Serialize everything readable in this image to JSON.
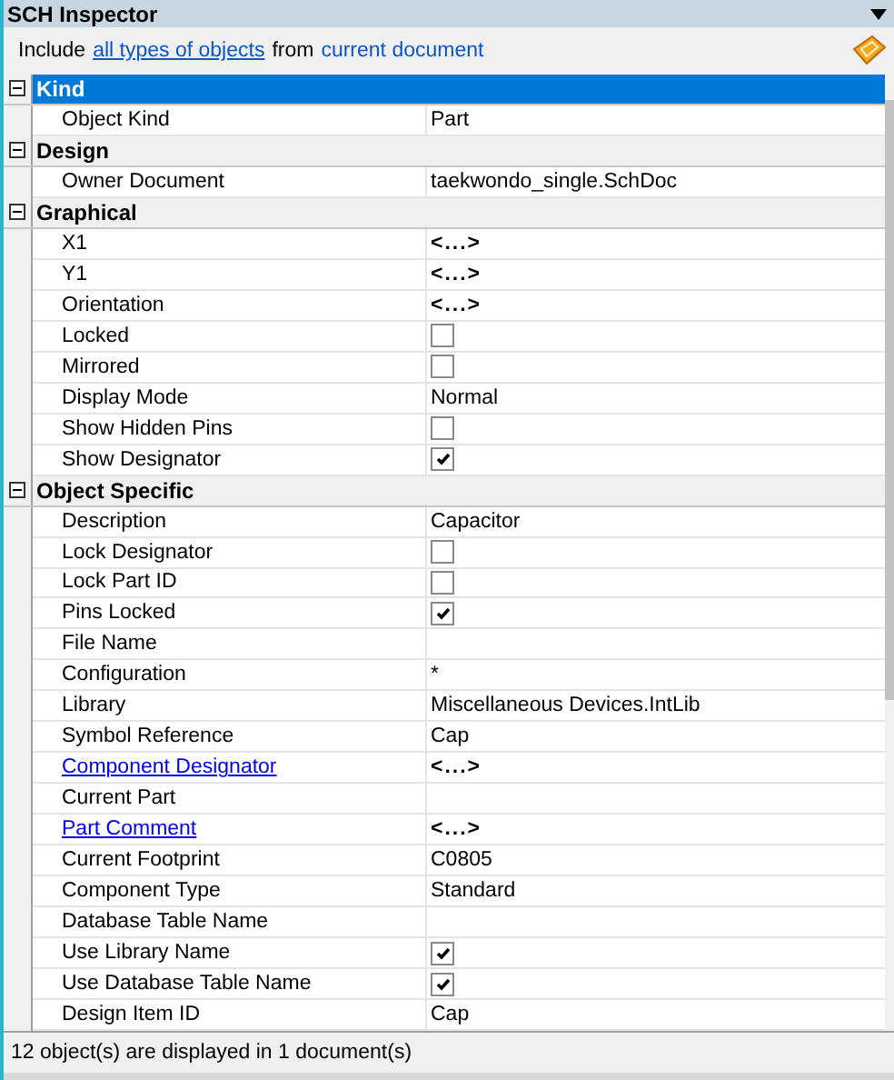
{
  "panel": {
    "title": "SCH Inspector"
  },
  "filter": {
    "prefix": "Include",
    "objects_link": "all types of objects",
    "middle": "from",
    "scope_link": "current document"
  },
  "categories": [
    {
      "name": "Kind",
      "selected": true,
      "expanded": true,
      "properties": [
        {
          "label": "Object Kind",
          "kind": "text",
          "link": false,
          "value": "Part"
        }
      ]
    },
    {
      "name": "Design",
      "selected": false,
      "expanded": true,
      "properties": [
        {
          "label": "Owner Document",
          "kind": "text",
          "link": false,
          "value": "taekwondo_single.SchDoc"
        }
      ]
    },
    {
      "name": "Graphical",
      "selected": false,
      "expanded": true,
      "properties": [
        {
          "label": "X1",
          "kind": "multi",
          "link": false,
          "value": "<...>"
        },
        {
          "label": "Y1",
          "kind": "multi",
          "link": false,
          "value": "<...>"
        },
        {
          "label": "Orientation",
          "kind": "multi",
          "link": false,
          "value": "<...>"
        },
        {
          "label": "Locked",
          "kind": "check",
          "link": false,
          "checked": false
        },
        {
          "label": "Mirrored",
          "kind": "check",
          "link": false,
          "checked": false
        },
        {
          "label": "Display Mode",
          "kind": "text",
          "link": false,
          "value": "Normal"
        },
        {
          "label": "Show Hidden Pins",
          "kind": "check",
          "link": false,
          "checked": false
        },
        {
          "label": "Show Designator",
          "kind": "check",
          "link": false,
          "checked": true
        }
      ]
    },
    {
      "name": "Object Specific",
      "selected": false,
      "expanded": true,
      "properties": [
        {
          "label": "Description",
          "kind": "text",
          "link": false,
          "value": "Capacitor"
        },
        {
          "label": "Lock Designator",
          "kind": "check",
          "link": false,
          "checked": false
        },
        {
          "label": "Lock Part ID",
          "kind": "check",
          "link": false,
          "checked": false
        },
        {
          "label": "Pins Locked",
          "kind": "check",
          "link": false,
          "checked": true
        },
        {
          "label": "File Name",
          "kind": "text",
          "link": false
        },
        {
          "label": "Configuration",
          "kind": "text",
          "link": false,
          "value": "*"
        },
        {
          "label": "Library",
          "kind": "text",
          "link": false,
          "value": "Miscellaneous Devices.IntLib"
        },
        {
          "label": "Symbol Reference",
          "kind": "text",
          "link": false,
          "value": "Cap"
        },
        {
          "label": "Component Designator",
          "kind": "multi",
          "link": true,
          "value": "<...>"
        },
        {
          "label": "Current Part",
          "kind": "text",
          "link": false
        },
        {
          "label": "Part Comment",
          "kind": "multi",
          "link": true,
          "value": "<...>"
        },
        {
          "label": "Current Footprint",
          "kind": "text",
          "link": false,
          "value": "C0805"
        },
        {
          "label": "Component Type",
          "kind": "text",
          "link": false,
          "value": "Standard"
        },
        {
          "label": "Database Table Name",
          "kind": "text",
          "link": false
        },
        {
          "label": "Use Library Name",
          "kind": "check",
          "link": false,
          "checked": true
        },
        {
          "label": "Use Database Table Name",
          "kind": "check",
          "link": false,
          "checked": true
        },
        {
          "label": "Design Item ID",
          "kind": "text",
          "link": false,
          "value": "Cap"
        }
      ]
    }
  ],
  "status_bar": "12 object(s) are displayed in 1 document(s)"
}
